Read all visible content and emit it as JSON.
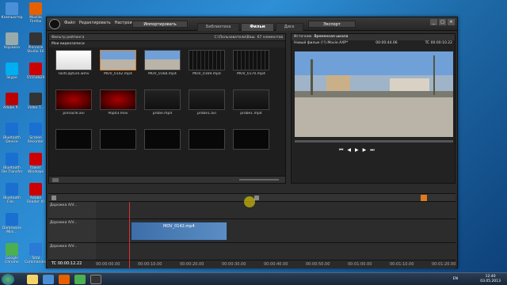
{
  "desktop": {
    "icons": [
      {
        "label": "Компьютер",
        "col": "#4a90d9"
      },
      {
        "label": "Mozilla Firefox",
        "col": "#e66000"
      },
      {
        "label": "Корзина",
        "col": "#9aa"
      },
      {
        "label": "Pinnacle Studio 16",
        "col": "#333"
      },
      {
        "label": "Skype",
        "col": "#00aff0"
      },
      {
        "label": "55554829",
        "col": "#c00"
      },
      {
        "label": "Adobe P...",
        "col": "#b00"
      },
      {
        "label": "Video T...",
        "col": "#333"
      },
      {
        "label": "Bluetooth Device",
        "col": "#1a6fd0"
      },
      {
        "label": "Screen Recorder",
        "col": "#1a6fd0"
      },
      {
        "label": "Bluetooth File Transfer",
        "col": "#1a6fd0"
      },
      {
        "label": "Пакет Windows",
        "col": "#c00"
      },
      {
        "label": "Bluetooth File...",
        "col": "#1a6fd0"
      },
      {
        "label": "Adobe Reader XI",
        "col": "#c00"
      },
      {
        "label": "Dameware Mini...",
        "col": "#1a6fd0"
      },
      {
        "label": "Google Chrome",
        "col": "#4caf50"
      },
      {
        "label": "Total Commander",
        "col": "#2a7ad6"
      }
    ]
  },
  "app": {
    "menu": [
      "Файл",
      "Редактировать",
      "Настроить",
      "Эл. магазин",
      "?"
    ],
    "import_label": "Импортировать",
    "tabs": [
      "Библиотека",
      "Фильм",
      "Диск"
    ],
    "export_label": "Экспорт",
    "window_controls": [
      "_",
      "□",
      "✕"
    ]
  },
  "library": {
    "filter_label": "Фильтр рейтинга",
    "path": "C:\\Пользователи\\Ваш",
    "group": "Мои видеозаписи",
    "count": "67 элементов",
    "clips": [
      {
        "name": "FastCapture.wmv",
        "kind": "doc"
      },
      {
        "name": "MOV_0142.mp4",
        "kind": "street",
        "selected": true
      },
      {
        "name": "MOV_0168.mp4",
        "kind": "street"
      },
      {
        "name": "MOV_0169.mp4",
        "kind": "film"
      },
      {
        "name": "MOV_0170.mp4",
        "kind": "film"
      },
      {
        "name": "pinnacle.avi",
        "kind": "red"
      },
      {
        "name": "Pop03.mov",
        "kind": "red"
      },
      {
        "name": "probe.mp4",
        "kind": "dark"
      },
      {
        "name": "probe1.avi",
        "kind": "dark"
      },
      {
        "name": "probe1.mp4",
        "kind": "dark"
      },
      {
        "name": "",
        "kind": "black"
      },
      {
        "name": "",
        "kind": "black"
      },
      {
        "name": "",
        "kind": "black"
      },
      {
        "name": "",
        "kind": "black"
      },
      {
        "name": "",
        "kind": "black"
      }
    ]
  },
  "preview": {
    "tabs": [
      "Источник",
      "Временная шкала"
    ],
    "title": "Новый фильм (!!).Movie.AXP*",
    "tc_left": "00:00:44.06",
    "tc_right": "TC 00:00:10.22"
  },
  "timeline": {
    "tracks": [
      {
        "label": "Дорожка A/V...",
        "type": "video"
      },
      {
        "label": "Дорожка A/V...",
        "type": "video"
      },
      {
        "label": "Дорожка A/V...",
        "type": "video"
      }
    ],
    "clip_label": "MOV_0142.mp4",
    "timecode": "TC 00:00:12.22",
    "ruler": [
      "00:00:00.00",
      "00:00:10.00",
      "00:00:20.00",
      "00:00:30.00",
      "00:00:40.00",
      "00:00:50.00",
      "00:01:00.00",
      "00:01:10.00",
      "00:01:20.00"
    ]
  },
  "taskbar": {
    "lang": "EN",
    "time": "12:40",
    "date": "03.05.2013"
  }
}
